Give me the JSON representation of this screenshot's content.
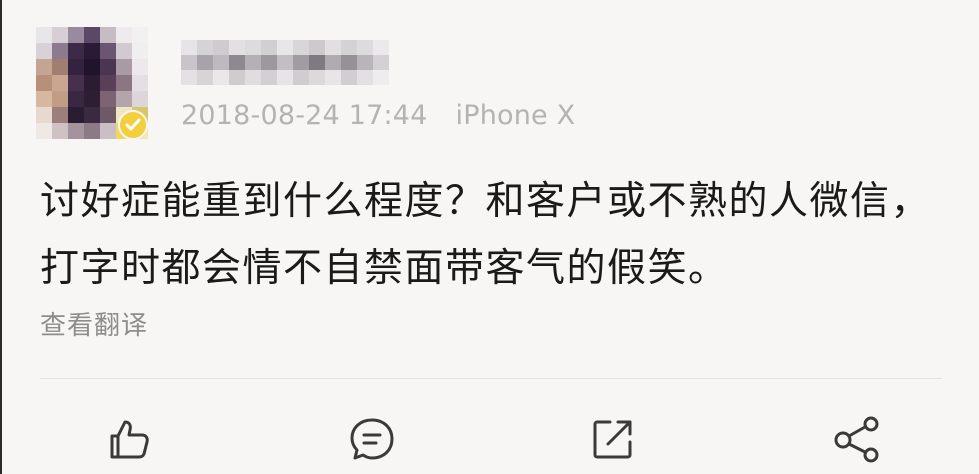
{
  "post": {
    "timestamp": "2018-08-24 17:44",
    "device": "iPhone X",
    "content": "讨好症能重到什么程度？和客户或不熟的人微信，打字时都会情不自禁面带客气的假笑。",
    "translate_label": "查看翻译"
  },
  "actions": [
    {
      "icon": "thumbs-up-icon"
    },
    {
      "icon": "comment-icon"
    },
    {
      "icon": "repost-icon"
    },
    {
      "icon": "share-icon"
    }
  ],
  "colors": {
    "background": "#f7f6f5",
    "text": "#1a1a1a",
    "meta": "#b3b3b3",
    "translate": "#8d8d8d",
    "verified_badge": "#f4cf3d"
  }
}
